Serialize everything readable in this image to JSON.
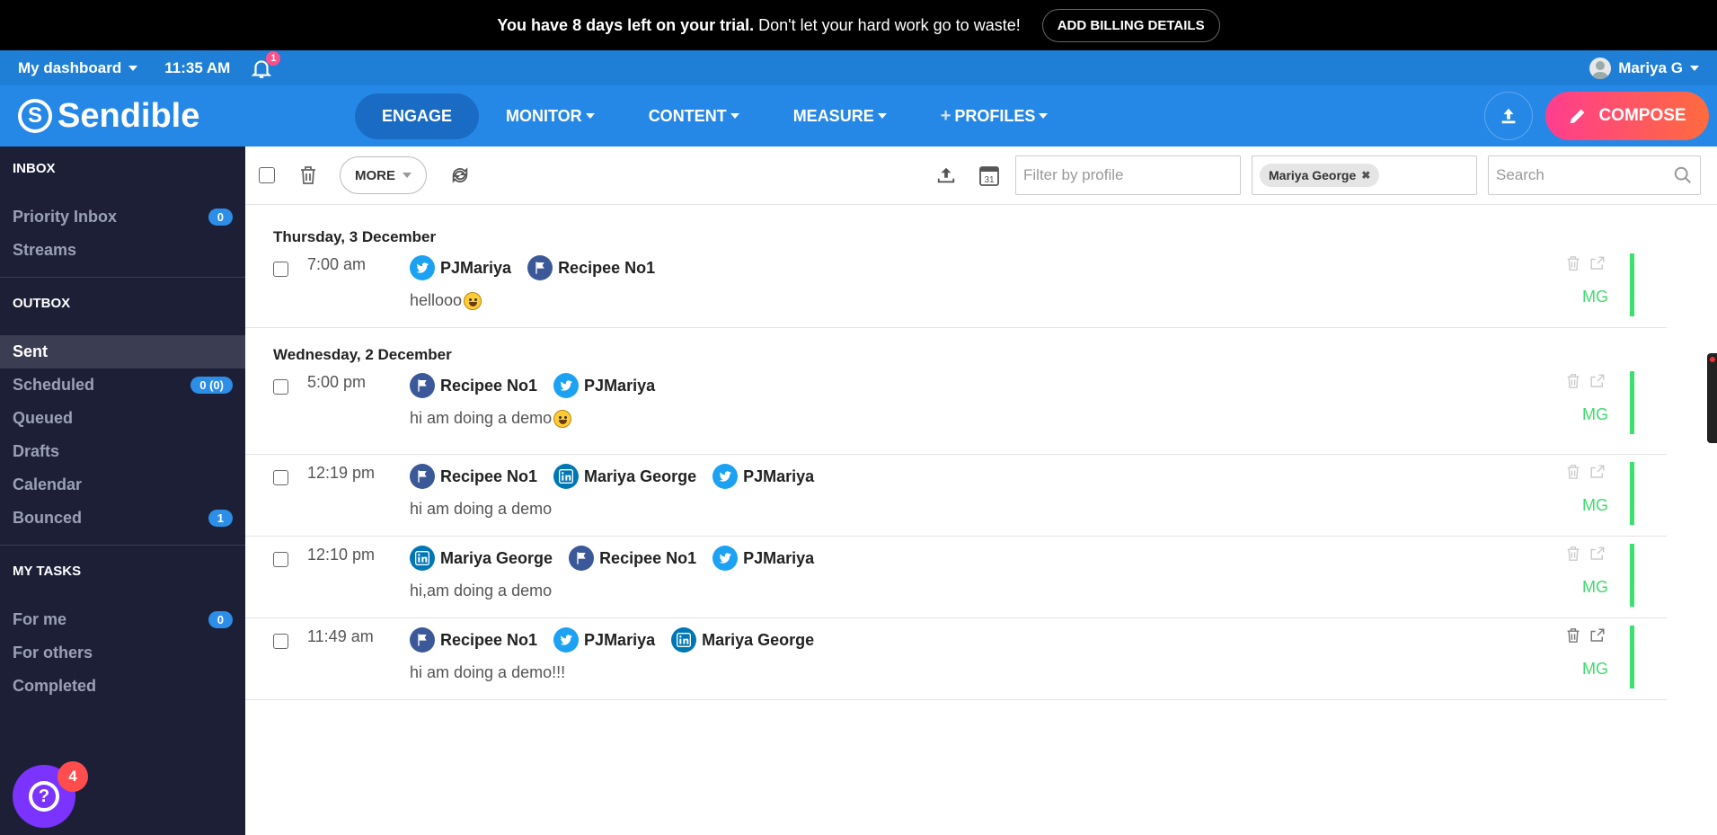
{
  "trial_banner": {
    "bold": "You have 8 days left on your trial.",
    "message": "Don't let your hard work go to waste!",
    "button": "ADD BILLING DETAILS"
  },
  "top_strip": {
    "dashboard": "My dashboard",
    "time": "11:35 AM",
    "notifications": "1",
    "user": "Mariya G"
  },
  "nav": {
    "logo": "Sendible",
    "items": [
      "ENGAGE",
      "MONITOR",
      "CONTENT",
      "MEASURE",
      "PROFILES"
    ],
    "compose": "COMPOSE"
  },
  "sidebar": {
    "inbox_heading": "INBOX",
    "priority_inbox": "Priority Inbox",
    "priority_count": "0",
    "streams": "Streams",
    "outbox_heading": "OUTBOX",
    "sent": "Sent",
    "scheduled": "Scheduled",
    "scheduled_count": "0 (0)",
    "queued": "Queued",
    "drafts": "Drafts",
    "calendar": "Calendar",
    "bounced": "Bounced",
    "bounced_count": "1",
    "tasks_heading": "MY TASKS",
    "for_me": "For me",
    "for_me_count": "0",
    "for_others": "For others",
    "completed": "Completed",
    "help_badge": "4"
  },
  "toolbar": {
    "more": "MORE",
    "calendar_day": "31",
    "filter_placeholder": "Filter by profile",
    "profile_chip": "Mariya George",
    "search_placeholder": "Search"
  },
  "groups": [
    {
      "date": "Thursday, 3 December",
      "posts": [
        {
          "time": "7:00 am",
          "profiles": [
            {
              "type": "tw",
              "name": "PJMariya"
            },
            {
              "type": "fb",
              "name": "Recipee No1"
            }
          ],
          "text": "hellooo",
          "initials": "MG"
        }
      ]
    },
    {
      "date": "Wednesday, 2 December",
      "posts": [
        {
          "time": "5:00 pm",
          "profiles": [
            {
              "type": "fb",
              "name": "Recipee No1"
            },
            {
              "type": "tw",
              "name": "PJMariya"
            }
          ],
          "text": "hi am doing a demo",
          "initials": "MG"
        },
        {
          "time": "12:19 pm",
          "profiles": [
            {
              "type": "fb",
              "name": "Recipee No1"
            },
            {
              "type": "li",
              "name": "Mariya George"
            },
            {
              "type": "tw",
              "name": "PJMariya"
            }
          ],
          "text": "hi am doing a demo",
          "initials": "MG"
        },
        {
          "time": "12:10 pm",
          "profiles": [
            {
              "type": "li",
              "name": "Mariya George"
            },
            {
              "type": "fb",
              "name": "Recipee No1"
            },
            {
              "type": "tw",
              "name": "PJMariya"
            }
          ],
          "text": "hi,am doing a demo",
          "initials": "MG"
        },
        {
          "time": "11:49 am",
          "profiles": [
            {
              "type": "fb",
              "name": "Recipee No1"
            },
            {
              "type": "tw",
              "name": "PJMariya"
            },
            {
              "type": "li",
              "name": "Mariya George"
            }
          ],
          "text": "hi am doing a demo!!!",
          "initials": "MG"
        }
      ]
    }
  ],
  "colors": {
    "nav_blue": "#2688e6",
    "sidebar_bg": "#1d1f37",
    "compose_start": "#ff3d8f",
    "compose_end": "#ff6b3d",
    "status_green": "#3be06f"
  }
}
